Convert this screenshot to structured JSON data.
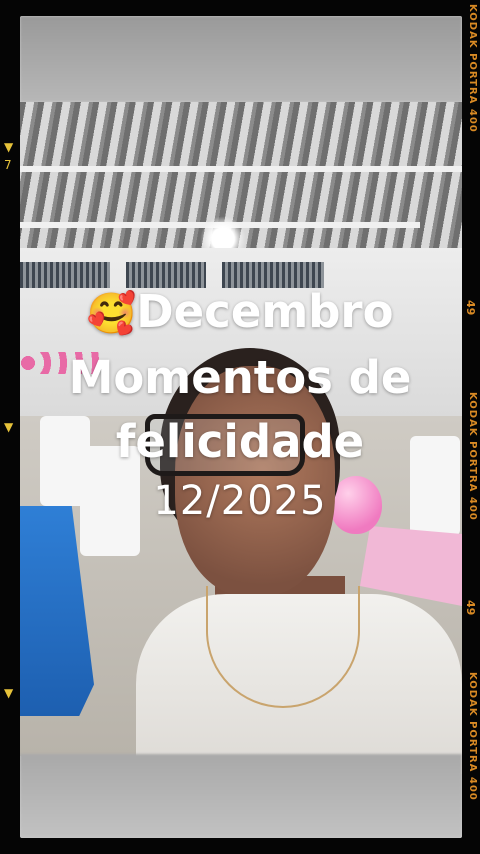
{
  "caption": {
    "emoji": "🥰",
    "line1": "Decembro",
    "line2": "Momentos de",
    "line3": "felicidade",
    "date": "12/2025"
  },
  "film_edge": {
    "label": "KODAK PORTRA 400",
    "frame_number": "49",
    "tick_left": "7"
  },
  "colors": {
    "caption_text": "#ffffff",
    "film_edge_text": "#d98a24",
    "frame_border": "#050505"
  }
}
